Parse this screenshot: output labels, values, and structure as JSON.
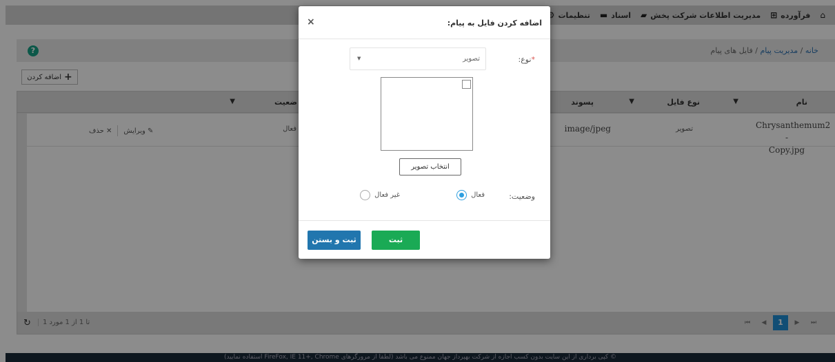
{
  "topbar": {
    "items": [
      {
        "label": "تنظیمات",
        "icon": "gears-icon"
      },
      {
        "label": "اسناد",
        "icon": "folder-icon"
      },
      {
        "label": "مدیریت اطلاعات شرکت پخش",
        "icon": "truck-icon"
      },
      {
        "label": "فرآورده",
        "icon": "plus-square-icon"
      }
    ],
    "home_icon": "home-icon"
  },
  "breadcrumb": {
    "home": "خانه",
    "section": "مدیریت پیام",
    "page": "فایل های پیام",
    "separator": "/"
  },
  "toolbar": {
    "add_label": "اضافه کردن"
  },
  "grid": {
    "columns": {
      "name": "نام",
      "file_type": "نوع فایل",
      "extension": "پسوند",
      "status": "ضعیت"
    },
    "rows": [
      {
        "name_line1": "Chrysanthemum2 -",
        "name_line2": "Copy.jpg",
        "file_type": "تصویر",
        "extension": "image/jpeg",
        "status": "فعال",
        "edit_label": "ویرایش",
        "delete_label": "حذف"
      }
    ],
    "footer": {
      "info": "1 تا 1 از 1 مورد",
      "current_page": "1"
    }
  },
  "footer_text": "© کپی برداری از این سایت بدون کسب اجازه از شرکت بهپرداز جهان ممنوع می باشد (لطفا از مرورگرهای FireFox, IE 11+, Chrome استفاده نمایید)",
  "modal": {
    "title": "اضافه کردن فایل به پیام:",
    "type_label": "نوع:",
    "type_value": "تصویر",
    "choose_image_label": "انتخاب تصویر",
    "status_label": "وضعیت:",
    "status_active": "فعال",
    "status_inactive": "غیر فعال",
    "status_selected": "active",
    "submit_label": "ثبت",
    "submit_close_label": "ثبت و بستن"
  },
  "colors": {
    "submit": "#1aaa55",
    "submit_close": "#2176ae",
    "pager_active": "#1f8fd6",
    "help": "#16a085"
  }
}
